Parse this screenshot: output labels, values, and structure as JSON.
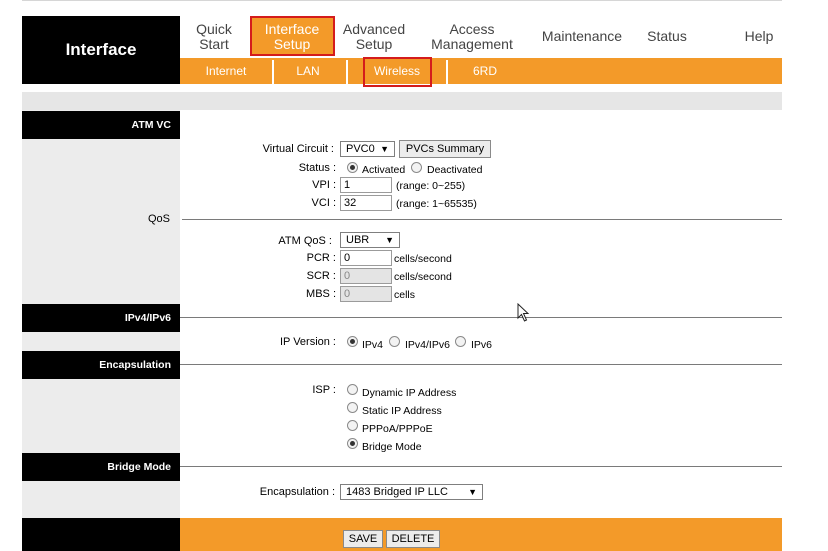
{
  "brand": "Interface",
  "nav": [
    {
      "label": "Quick\nStart"
    },
    {
      "label": "Interface\nSetup"
    },
    {
      "label": "Advanced\nSetup"
    },
    {
      "label": "Access\nManagement"
    },
    {
      "label": "Maintenance"
    },
    {
      "label": "Status"
    },
    {
      "label": "Help"
    }
  ],
  "subnav": [
    "Internet",
    "LAN",
    "Wireless",
    "6RD"
  ],
  "sections": {
    "atm_vc": "ATM VC",
    "qos": "QoS",
    "ipv4ipv6": "IPv4/IPv6",
    "encapsulation": "Encapsulation",
    "bridge_mode": "Bridge Mode"
  },
  "atm": {
    "virtual_circuit_label": "Virtual Circuit :",
    "virtual_circuit_value": "PVC0",
    "pvcs_summary_button": "PVCs Summary",
    "status_label": "Status :",
    "status_activated": "Activated",
    "status_deactivated": "Deactivated",
    "vpi_label": "VPI :",
    "vpi_value": "1",
    "vpi_range": "(range: 0~255)",
    "vci_label": "VCI :",
    "vci_value": "32",
    "vci_range": "(range: 1~65535)"
  },
  "qos": {
    "atm_qos_label": "ATM QoS :",
    "atm_qos_value": "UBR",
    "pcr_label": "PCR :",
    "pcr_value": "0",
    "pcr_unit": "cells/second",
    "scr_label": "SCR :",
    "scr_value": "0",
    "scr_unit": "cells/second",
    "mbs_label": "MBS :",
    "mbs_value": "0",
    "mbs_unit": "cells"
  },
  "ip": {
    "label": "IP Version :",
    "options": [
      "IPv4",
      "IPv4/IPv6",
      "IPv6"
    ],
    "selected": "IPv4"
  },
  "isp": {
    "label": "ISP :",
    "options": [
      "Dynamic IP Address",
      "Static IP Address",
      "PPPoA/PPPoE",
      "Bridge Mode"
    ],
    "selected": "Bridge Mode"
  },
  "bridge": {
    "encapsulation_label": "Encapsulation :",
    "encapsulation_value": "1483 Bridged IP LLC"
  },
  "buttons": {
    "save": "SAVE",
    "delete": "DELETE"
  },
  "colors": {
    "accent": "#f39a29",
    "highlight": "#d41c1c",
    "header_bg": "#000000"
  }
}
